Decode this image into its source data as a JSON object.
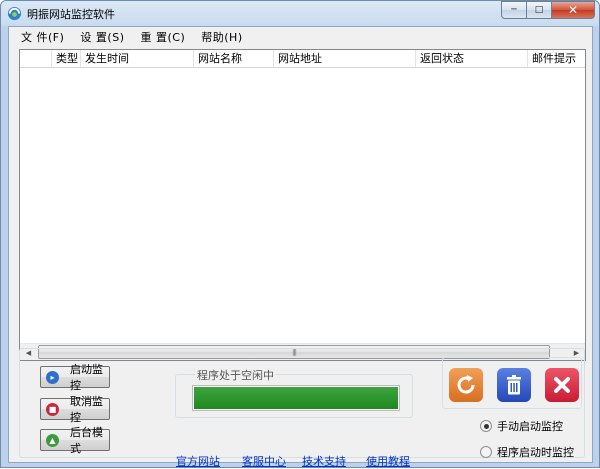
{
  "window": {
    "title": "明振网站监控软件",
    "min_label": "─",
    "max_label": "□",
    "close_label": "✕"
  },
  "menu": [
    "文 件(F)",
    "设 置(S)",
    "重 置(C)",
    "帮助(H)"
  ],
  "table": {
    "columns": [
      "",
      "类型",
      "发生时间",
      "网站名称",
      "网站地址",
      "返回状态",
      "邮件提示"
    ],
    "rows": []
  },
  "scrollbar": {
    "left_arrow": "◀",
    "right_arrow": "▶",
    "grip": "|||"
  },
  "buttons": {
    "start": "启动监控",
    "cancel": "取消监控",
    "background": "后台模式"
  },
  "status": {
    "label": "程序处于空闲中",
    "progress": 1.0
  },
  "links": [
    "官方网站",
    "客服中心",
    "技术支持",
    "使用教程"
  ],
  "radios": [
    {
      "label": "手动启动监控",
      "checked": true
    },
    {
      "label": "程序启动时监控",
      "checked": false
    }
  ],
  "colors": {
    "status_fill": "#1e8a1e",
    "refresh": "#e07a2e",
    "delete": "#2f57c9",
    "close": "#d8283e"
  }
}
